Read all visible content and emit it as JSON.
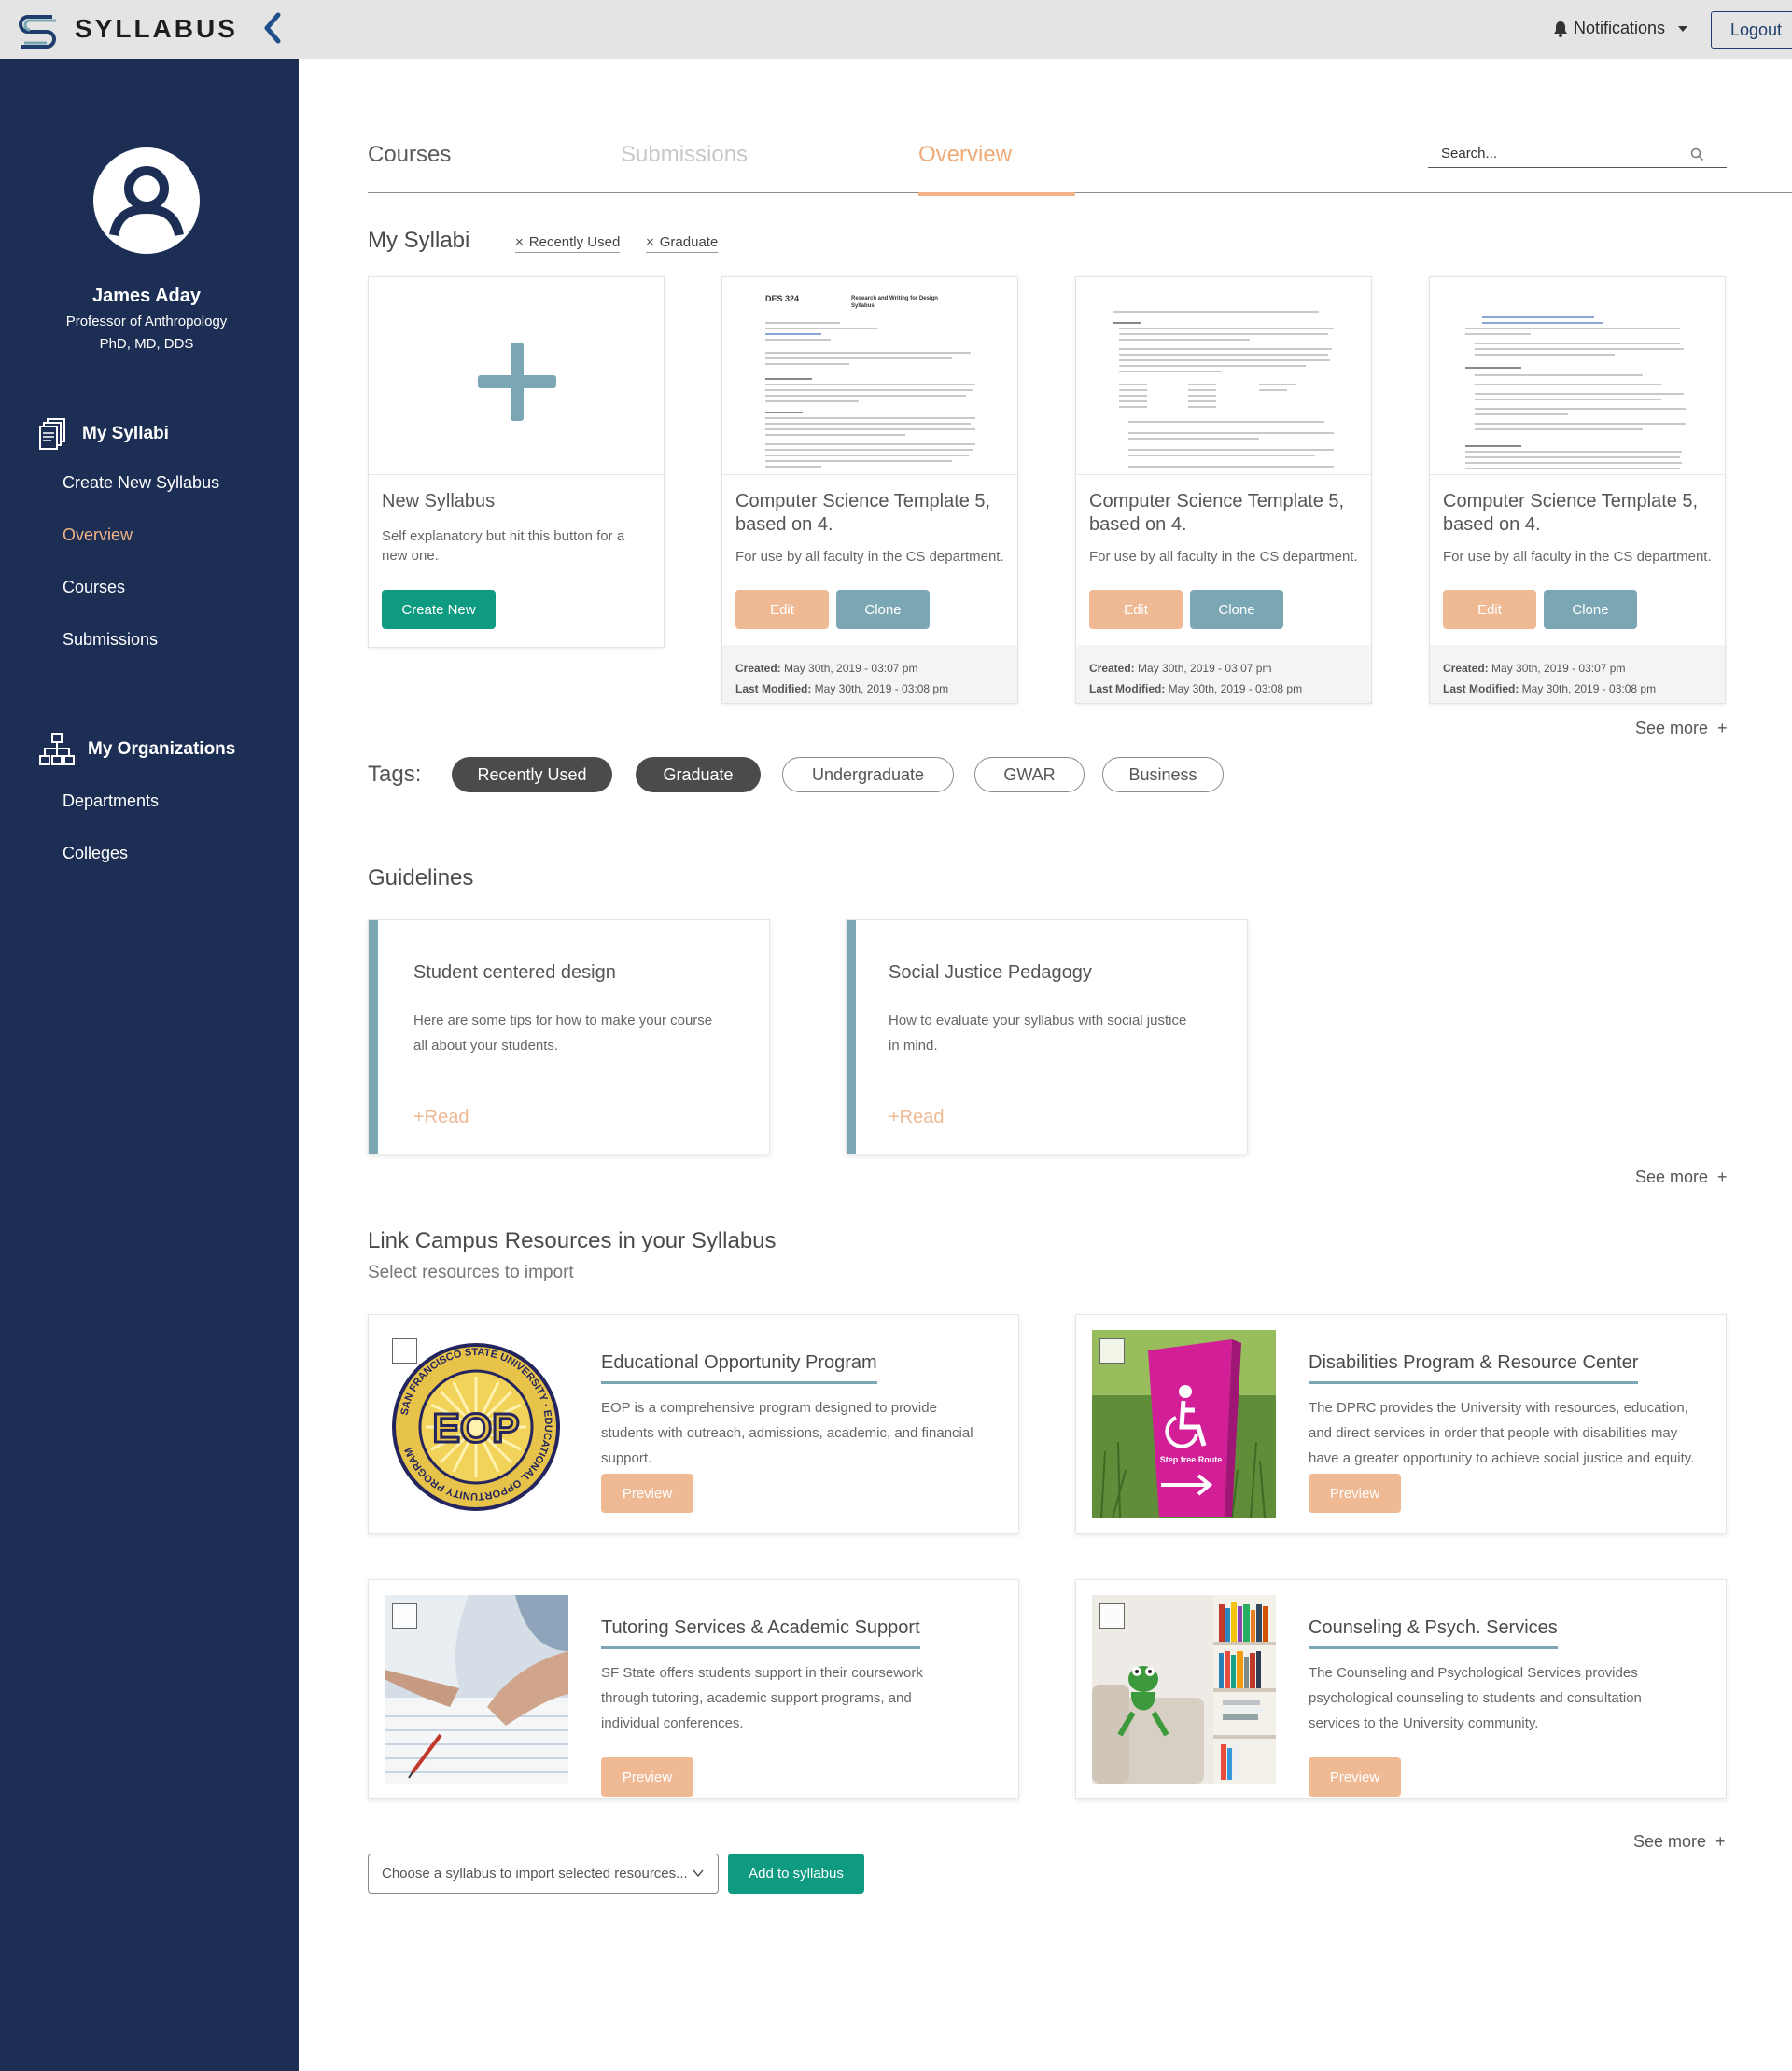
{
  "app": {
    "brand": "Syllabus"
  },
  "topbar": {
    "notifications_label": "Notifications",
    "logout_label": "Logout"
  },
  "user": {
    "name": "James Aday",
    "title": "Professor of Anthropology",
    "degrees": "PhD, MD, DDS"
  },
  "sidebar": {
    "my_syllabi": "My Syllabi",
    "syllabi_items": [
      {
        "label": "Create New Syllabus"
      },
      {
        "label": "Overview",
        "active": true
      },
      {
        "label": "Courses"
      },
      {
        "label": "Submissions"
      }
    ],
    "my_orgs": "My Organizations",
    "org_items": [
      {
        "label": "Departments"
      },
      {
        "label": "Colleges"
      }
    ]
  },
  "tabs": [
    {
      "label": "Courses"
    },
    {
      "label": "Submissions"
    },
    {
      "label": "Overview",
      "active": true
    }
  ],
  "search": {
    "placeholder": "Search..."
  },
  "my_syllabi": {
    "heading": "My Syllabi",
    "filters": [
      {
        "label": "Recently Used"
      },
      {
        "label": "Graduate"
      }
    ],
    "new_card": {
      "title": "New Syllabus",
      "description": "Self explanatory but hit this button for a new one.",
      "button": "Create New"
    },
    "cards": [
      {
        "title": "Computer Science Template 5, based on 4.",
        "description": "For use by all faculty in the CS department.",
        "edit": "Edit",
        "clone": "Clone",
        "created_label": "Created:",
        "created": "May 30th, 2019 - 03:07 pm",
        "modified_label": "Last Modified:",
        "modified": "May 30th, 2019 - 03:08 pm",
        "doc_title": "DES 324",
        "doc_subtitle": "Research and Writing for Design Syllabus"
      },
      {
        "title": "Computer Science Template 5, based on 4.",
        "description": "For use by all faculty in the CS department.",
        "edit": "Edit",
        "clone": "Clone",
        "created_label": "Created:",
        "created": "May 30th, 2019 - 03:07 pm",
        "modified_label": "Last Modified:",
        "modified": "May 30th, 2019 - 03:08 pm"
      },
      {
        "title": "Computer Science Template 5, based on 4.",
        "description": "For use by all faculty in the CS department.",
        "edit": "Edit",
        "clone": "Clone",
        "created_label": "Created:",
        "created": "May 30th, 2019 - 03:07 pm",
        "modified_label": "Last Modified:",
        "modified": "May 30th, 2019 - 03:08 pm"
      }
    ],
    "see_more": "See more"
  },
  "tags": {
    "label": "Tags:",
    "items": [
      {
        "label": "Recently Used",
        "selected": true
      },
      {
        "label": "Graduate",
        "selected": true
      },
      {
        "label": "Undergraduate",
        "selected": false
      },
      {
        "label": "GWAR",
        "selected": false
      },
      {
        "label": "Business",
        "selected": false
      }
    ]
  },
  "guidelines": {
    "heading": "Guidelines",
    "items": [
      {
        "title": "Student centered design",
        "description": "Here are some tips for how to make your course all about your students.",
        "read": "+Read"
      },
      {
        "title": "Social Justice Pedagogy",
        "description": "How to evaluate your syllabus with social justice in mind.",
        "read": "+Read"
      }
    ],
    "see_more": "See more"
  },
  "resources": {
    "heading": "Link Campus Resources in your Syllabus",
    "subheading": "Select resources to import",
    "items": [
      {
        "title": "Educational Opportunity Program",
        "description": "EOP is a comprehensive program designed to provide students with outreach, admissions, academic, and financial support.",
        "preview": "Preview",
        "image_text": "EOP",
        "seal_text": "SAN FRANCISCO STATE UNIVERSITY · EDUCATIONAL OPPORTUNITY PROGRAM"
      },
      {
        "title": "Disabilities Program & Resource Center",
        "description": "The DPRC provides the University with resources, education, and direct services in order that people with disabilities may have a greater opportunity to achieve social justice and equity.",
        "preview": "Preview",
        "image_text": "Step free Route"
      },
      {
        "title": "Tutoring Services & Academic Support",
        "description": "SF State offers students support in their  coursework through tutoring, academic support programs, and individual conferences.",
        "preview": "Preview"
      },
      {
        "title": "Counseling & Psych. Services",
        "description": "The Counseling and Psychological Services provides psychological counseling to students and consultation services to the University community.",
        "preview": "Preview"
      }
    ],
    "see_more": "See more",
    "select_placeholder": "Choose a syllabus to import selected resources...",
    "add_button": "Add to syllabus"
  },
  "colors": {
    "sidebar": "#1c2e54",
    "accent_orange": "#f0b487",
    "accent_blue": "#7ba7b5",
    "green": "#0f9a82"
  }
}
